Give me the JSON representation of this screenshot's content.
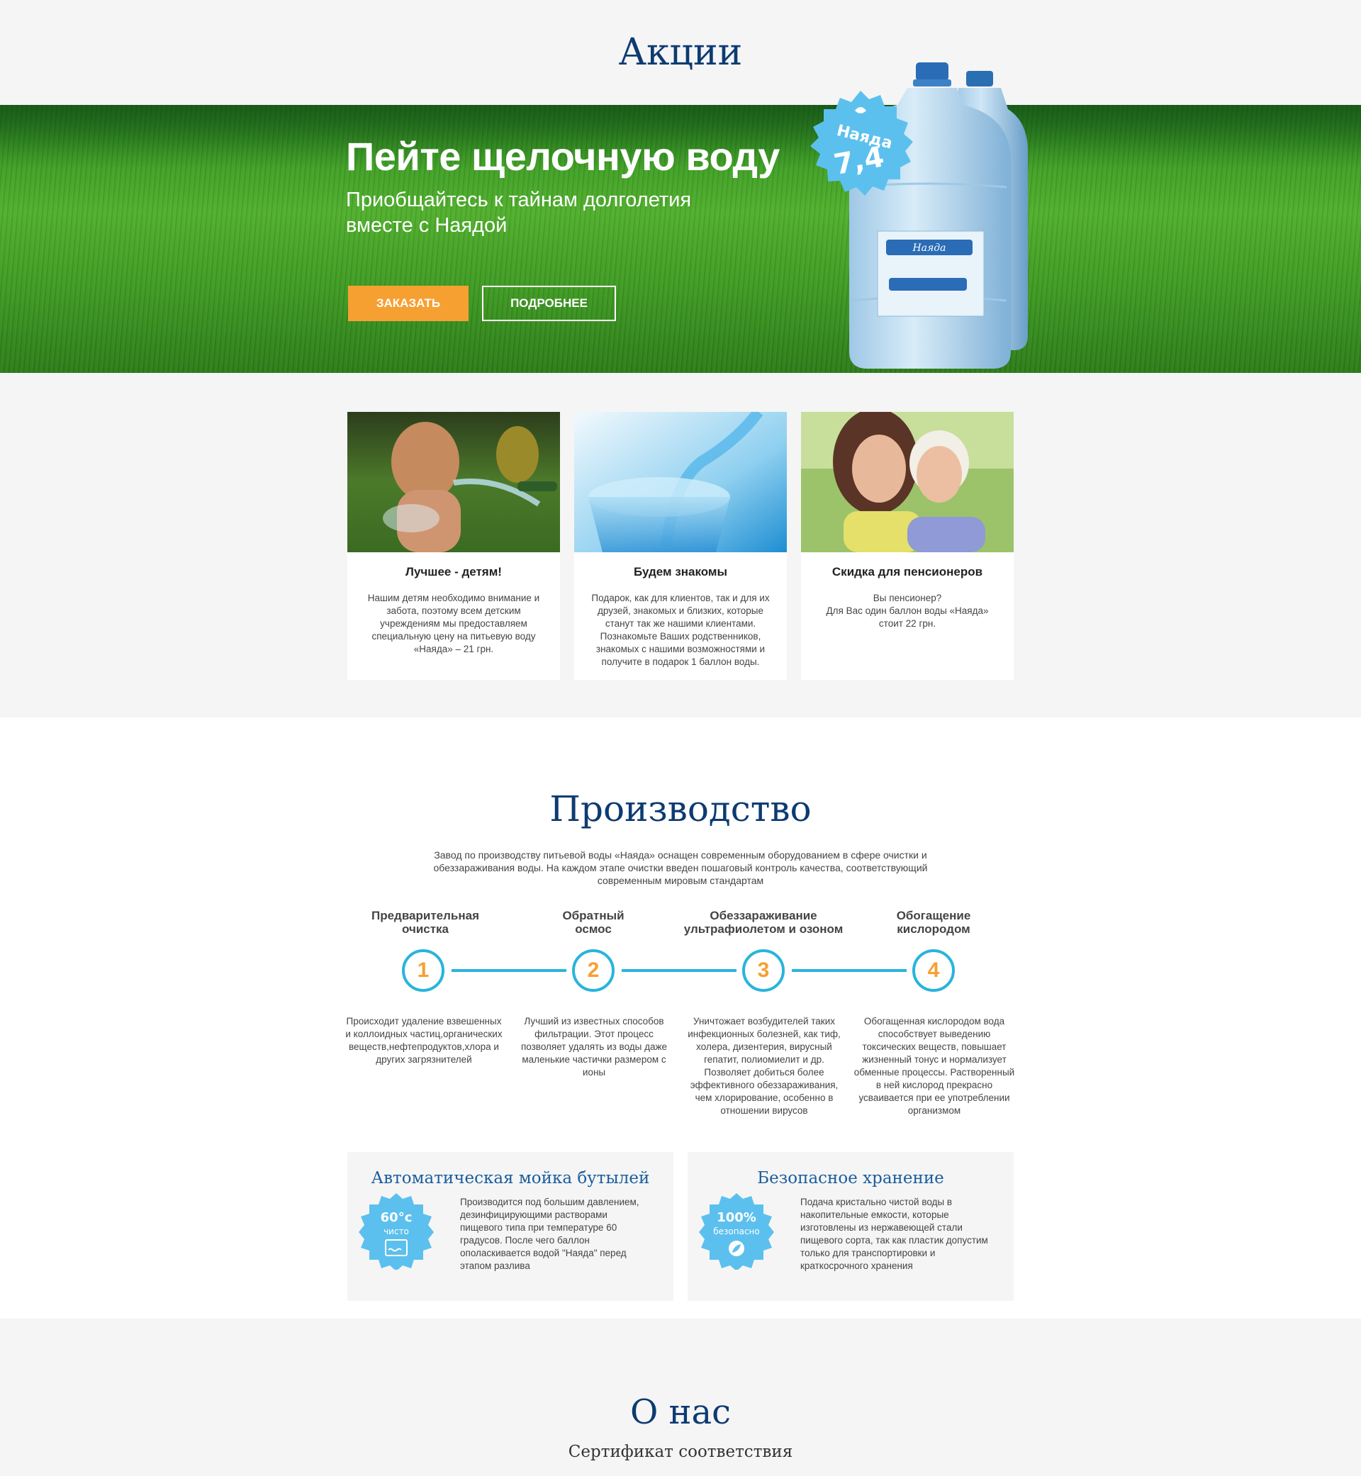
{
  "promo": {
    "title": "Акции"
  },
  "hero": {
    "title": "Пейте щелочную воду",
    "subtitle": "Приобщайтесь к тайнам долголетия вместе с Наядой",
    "order_button": "ЗАКАЗАТЬ",
    "more_button": "ПОДРОБНЕЕ",
    "badge_brand": "Наяда",
    "badge_value": "7,4",
    "label_brand": "Наяда"
  },
  "cards": [
    {
      "title": "Лучшее - детям!",
      "text": "Нашим детям необходимо внимание и забота, поэтому всем детским учреждениям мы предоставляем специальную цену на питьевую воду «Наяда» – 21 грн."
    },
    {
      "title": "Будем знакомы",
      "text": "Подарок, как для клиентов, так и для их друзей, знакомых и близких, которые станут так же нашими клиентами. Познакомьте Ваших родственников, знакомых с нашими возможностями и получите в подарок 1 баллон воды."
    },
    {
      "title": "Скидка для пенсионеров",
      "text": "Вы пенсионер?\nДля Вас один баллон воды «Наяда» стоит 22 грн."
    }
  ],
  "production": {
    "title": "Производство",
    "intro": "Завод по производству питьевой воды «Наяда» оснащен современным оборудованием в сфере очистки и обеззараживания воды. На каждом этапе очистки введен пошаговый контроль качества, соответствующий современным мировым стандартам",
    "steps": [
      {
        "number": "1",
        "title": "Предварительная\nочистка",
        "text": "Происходит удаление взвешенных и коллоидных частиц,органических веществ,нефтепродуктов,хлора и других загрязнителей"
      },
      {
        "number": "2",
        "title": "Обратный\nосмос",
        "text": "Лучший из известных способов фильтрации. Этот процесс позволяет удалять из воды даже маленькие частички размером с ионы"
      },
      {
        "number": "3",
        "title": "Обеззараживание\nультрафиолетом и озоном",
        "text": "Уничтожает возбудителей таких инфекционных болезней, как тиф, холера, дизентерия, вирусный гепатит, полиомиелит и др. Позволяет добиться более эффективного обеззараживания, чем хлорирование, особенно в отношении вирусов"
      },
      {
        "number": "4",
        "title": "Обогащение\nкислородом",
        "text": "Обогащенная кислородом вода способствует выведению токсических веществ, повышает жизненный тонус и нормализует обменные процессы. Растворенный в ней кислород прекрасно усваивается при ее употреблении организмом"
      }
    ],
    "features": [
      {
        "title": "Автоматическая мойка бутылей",
        "badge_top": "60°c",
        "badge_bottom": "чисто",
        "text": "Производится под большим давлением, дезинфицирующими растворами пищевого типа при температуре 60 градусов. После чего баллон ополаскивается водой \"Наяда\" перед этапом разлива"
      },
      {
        "title": "Безопасное хранение",
        "badge_top": "100%",
        "badge_bottom": "безопасно",
        "text": "Подача кристально чистой воды в накопительные емкости, которые изготовлены из нержавеющей стали пищевого сорта, так как пластик допустим только для транспортировки и краткосрочного хранения"
      }
    ]
  },
  "about": {
    "title": "О нас",
    "certificate": "Сертификат соответствия"
  },
  "colors": {
    "navy": "#0d3b72",
    "accent_orange": "#f7a032",
    "accent_cyan": "#29b4dc",
    "badge_blue": "#5cc0ee",
    "feature_title": "#1a5d9c"
  }
}
